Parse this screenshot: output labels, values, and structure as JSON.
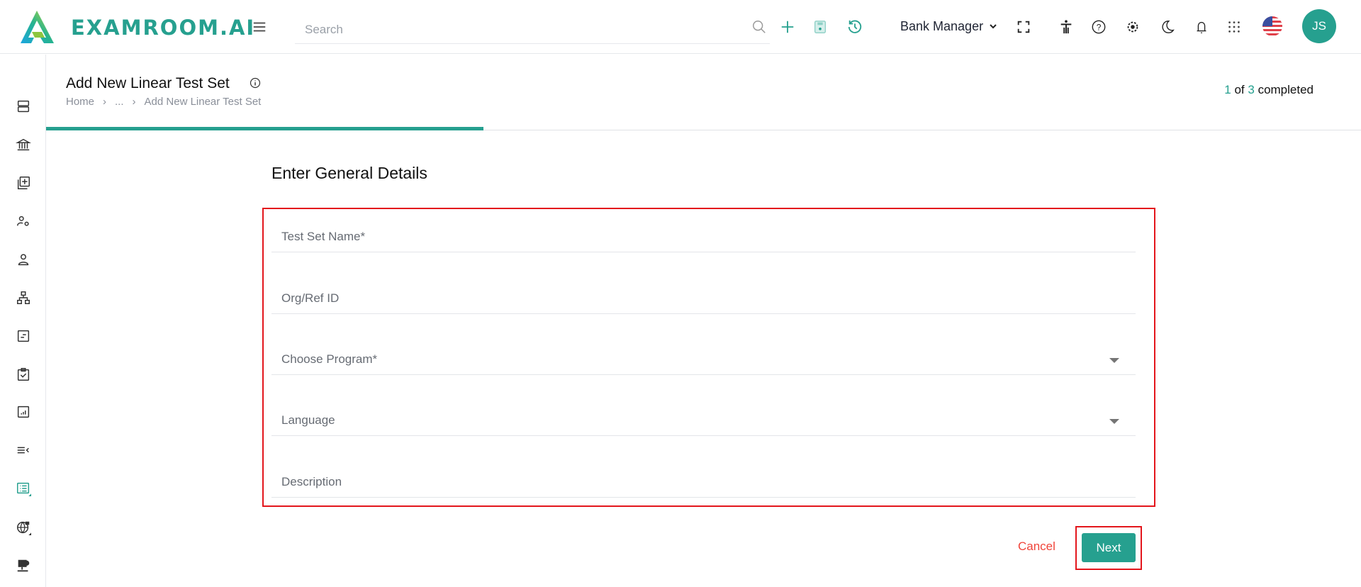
{
  "header": {
    "logo_text": "EXAMROOM.AI",
    "search_placeholder": "Search",
    "role": "Bank Manager",
    "avatar_initials": "JS",
    "icons": [
      "menu-icon",
      "search-icon",
      "plus-icon",
      "save-icon",
      "history-icon",
      "fullscreen-icon",
      "accessibility-icon",
      "help-icon",
      "gear-icon",
      "moon-icon",
      "bell-icon",
      "apps-grid-icon",
      "us-flag-icon"
    ]
  },
  "sidebar": {
    "icons": [
      "server-icon",
      "bank-icon",
      "add-library-icon",
      "user-settings-icon",
      "user-icon",
      "hierarchy-icon",
      "form-icon",
      "clipboard-check-icon",
      "report-chart-icon",
      "list-collapse-icon",
      "list-icon",
      "globe-icon",
      "computer-network-icon"
    ]
  },
  "page": {
    "title": "Add New Linear Test Set",
    "breadcrumb": [
      "Home",
      "...",
      "Add New Linear Test Set"
    ],
    "progress": {
      "current": "1",
      "of": "of",
      "total": "3",
      "suffix": "completed",
      "fraction": 0.3333
    }
  },
  "form": {
    "section_title": "Enter General Details",
    "fields": [
      {
        "label": "Test Set Name*",
        "type": "text"
      },
      {
        "label": "Org/Ref ID",
        "type": "text"
      },
      {
        "label": "Choose Program*",
        "type": "select"
      },
      {
        "label": "Language",
        "type": "select"
      },
      {
        "label": "Description",
        "type": "text"
      }
    ],
    "cancel_label": "Cancel",
    "next_label": "Next"
  },
  "colors": {
    "accent": "#26a08f",
    "highlight": "#e3161c",
    "cancel": "#f0443a"
  }
}
